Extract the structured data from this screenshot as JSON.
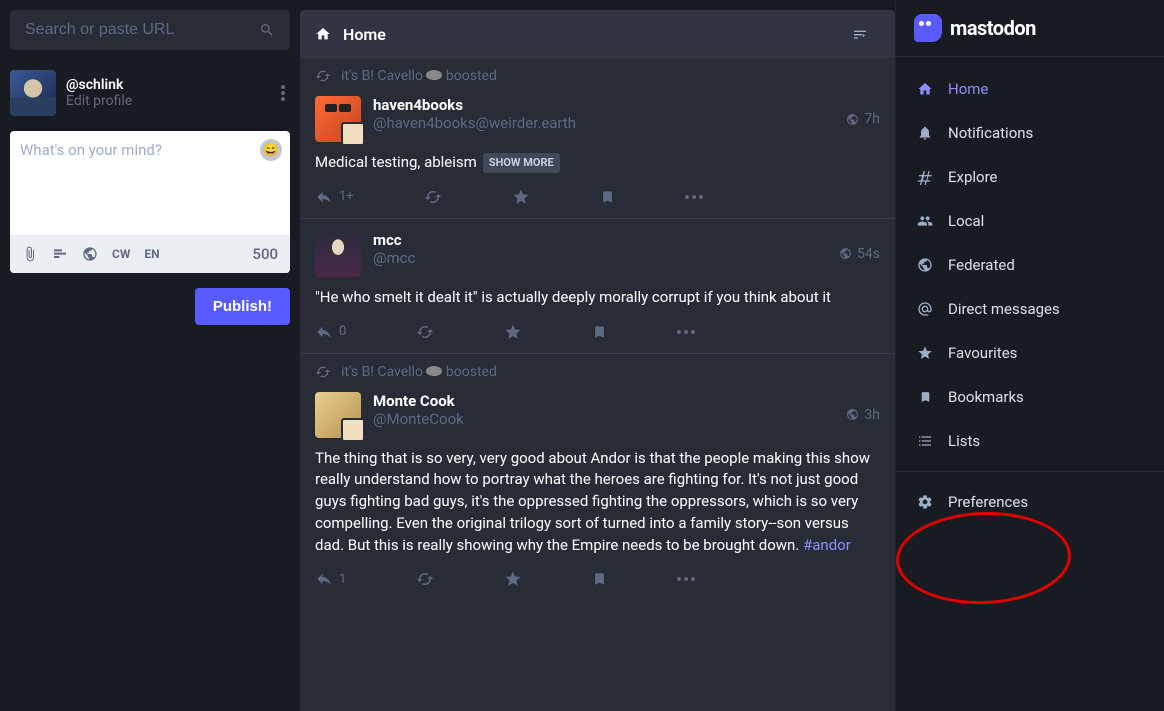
{
  "search": {
    "placeholder": "Search or paste URL"
  },
  "profile": {
    "handle": "@schlink",
    "edit": "Edit profile"
  },
  "compose": {
    "placeholder": "What's on your mind?",
    "cw": "CW",
    "lang": "EN",
    "chars": "500",
    "publish": "Publish!"
  },
  "column": {
    "title": "Home"
  },
  "boosted_by": "it's B! Cavello",
  "boosted_verb": "boosted",
  "posts": [
    {
      "boosted": true,
      "name": "haven4books",
      "handle": "@haven4books@weirder.earth",
      "time": "7h",
      "body": "Medical testing, ableism",
      "show_more": "SHOW MORE",
      "reply_count": "1+"
    },
    {
      "boosted": false,
      "name": "mcc",
      "handle": "@mcc",
      "time": "54s",
      "body": "\"He who smelt it dealt it\" is actually deeply morally corrupt if you think about it",
      "reply_count": "0"
    },
    {
      "boosted": true,
      "name": "Monte Cook",
      "handle": "@MonteCook",
      "time": "3h",
      "body": "The thing that is so very, very good about Andor is that the people making this show really understand how to portray what the heroes are fighting for. It's not just good guys fighting bad guys, it's the oppressed fighting the oppressors, which is so very compelling. Even the original trilogy sort of turned into a family story--son versus dad. But this is really showing why the Empire needs to be brought down.",
      "hashtag": "#andor",
      "reply_count": "1"
    }
  ],
  "nav": {
    "home": "Home",
    "notifications": "Notifications",
    "explore": "Explore",
    "local": "Local",
    "federated": "Federated",
    "dm": "Direct messages",
    "favourites": "Favourites",
    "bookmarks": "Bookmarks",
    "lists": "Lists",
    "preferences": "Preferences"
  },
  "brand": "mastodon"
}
